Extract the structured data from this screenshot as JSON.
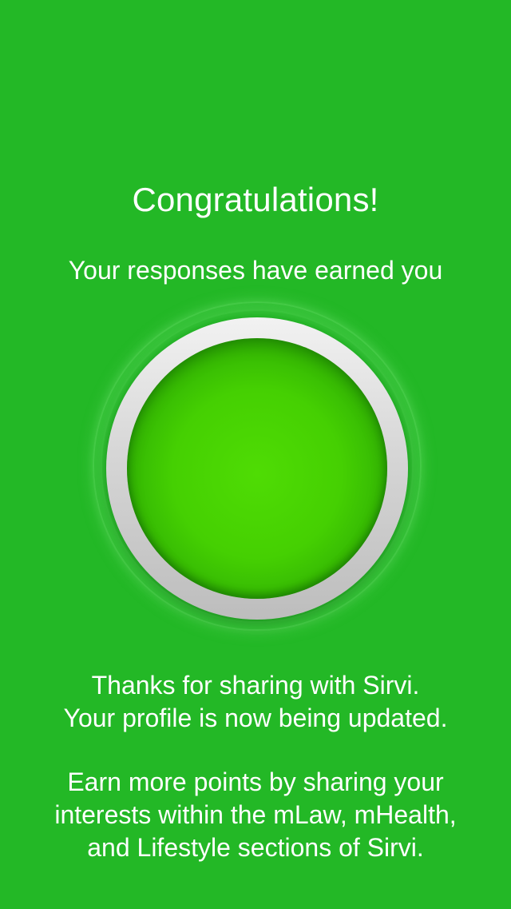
{
  "heading": {
    "title": "Congratulations!",
    "subtitle": "Your responses have earned you"
  },
  "badge": {
    "points_label": "",
    "ring_color": "#d6d6d6",
    "core_color": "#45d002"
  },
  "message": {
    "thanks_line1": "Thanks for sharing with Sirvi.",
    "thanks_line2": "Your profile is now being updated.",
    "earn_line1": "Earn more points by sharing your",
    "earn_line2": "interests within the mLaw, mHealth,",
    "earn_line3": "and Lifestyle sections of Sirvi."
  },
  "colors": {
    "background": "#23b826",
    "text": "#ffffff"
  }
}
